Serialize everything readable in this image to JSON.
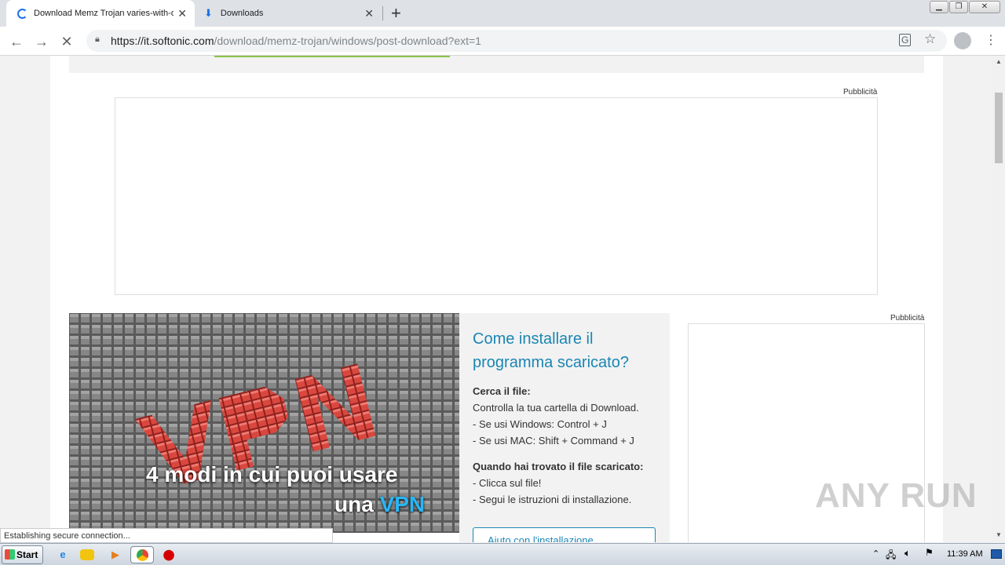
{
  "tabs": [
    {
      "title": "Download Memz Trojan varies-with-d",
      "state": "loading"
    },
    {
      "title": "Downloads",
      "icon": "download-icon"
    }
  ],
  "toolbar": {
    "url_host": "https://it.softonic.com",
    "url_path": "/download/memz-trojan/windows/post-download?ext=1"
  },
  "ads": {
    "label_top": "Pubblicità",
    "label_side": "Pubblicità"
  },
  "vpn_banner": {
    "line1": "4 modi in cui puoi usare",
    "line2_prefix": "una ",
    "line2_highlight": "VPN",
    "big_text": "VPN"
  },
  "install_help": {
    "title": "Come installare il programma scaricato?",
    "find_heading": "Cerca il file:",
    "find_lines": [
      "Controlla la tua cartella di Download.",
      "- Se usi Windows: Control + J",
      "- Se usi MAC: Shift + Command + J"
    ],
    "found_heading": "Quando hai trovato il file scaricato:",
    "found_lines": [
      "- Clicca sul file!",
      "- Segui le istruzioni di installazione."
    ],
    "button": "Aiuto con l'installazione"
  },
  "status": "Establishing secure connection...",
  "watermark": "ANY RUN",
  "taskbar": {
    "start": "Start",
    "clock": "11:39 AM"
  },
  "colors": {
    "accent": "#1a86b4",
    "vpn_red": "#d9473f",
    "vpn_blue": "#29b6f6"
  }
}
